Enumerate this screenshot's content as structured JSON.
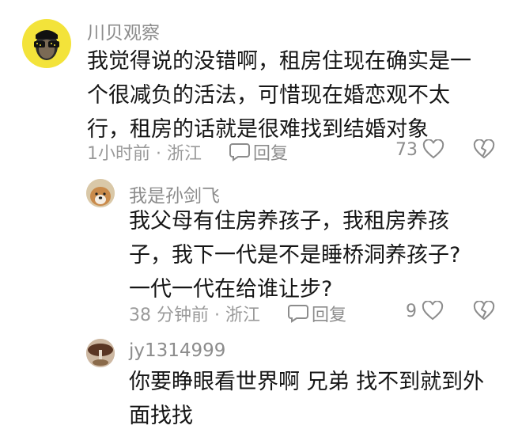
{
  "comments": [
    {
      "username": "川贝观察",
      "lines": [
        "我觉得说的没错啊，租房住现在确实是一",
        "个很减负的活法，可惜现在婚恋观不太",
        "行，租房的话就是很难找到结婚对象"
      ],
      "meta": "1小时前 · 浙江",
      "reply_label": "回复",
      "likes": "73"
    },
    {
      "username": "我是孙剑飞",
      "lines": [
        "我父母有住房养孩子，我租房养孩",
        "子，我下一代是不是睡桥洞养孩子?",
        "一代一代在给谁让步?"
      ],
      "meta": "38 分钟前 · 浙江",
      "reply_label": "回复",
      "likes": "9"
    },
    {
      "username": "jy1314999",
      "lines": [
        "你要睁眼看世界啊 兄弟 找不到就到外",
        "面找找"
      ]
    }
  ],
  "colors": {
    "text": "#161616",
    "secondary": "#8c8c8c",
    "avatar1_bg": "#f3e33a"
  },
  "icons": [
    "speech-bubble-icon",
    "heart-icon",
    "broken-heart-icon"
  ]
}
